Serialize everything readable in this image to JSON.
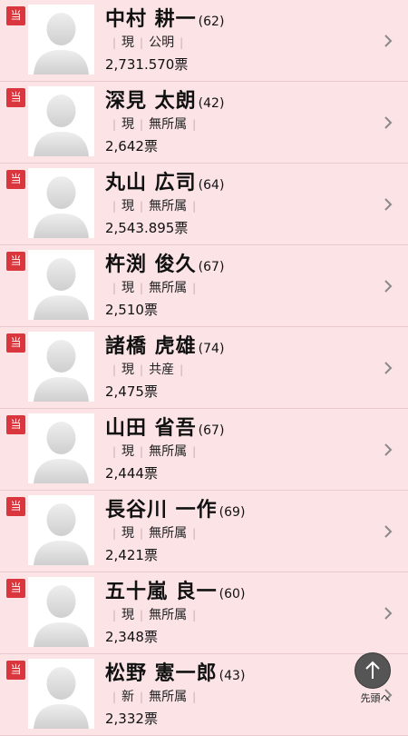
{
  "candidates": [
    {
      "badge": "当",
      "name": "中村 耕一",
      "age": "(62)",
      "status": "現",
      "party": "公明",
      "votes": "2,731.570票"
    },
    {
      "badge": "当",
      "name": "深見 太朗",
      "age": "(42)",
      "status": "現",
      "party": "無所属",
      "votes": "2,642票"
    },
    {
      "badge": "当",
      "name": "丸山 広司",
      "age": "(64)",
      "status": "現",
      "party": "無所属",
      "votes": "2,543.895票"
    },
    {
      "badge": "当",
      "name": "杵渕 俊久",
      "age": "(67)",
      "status": "現",
      "party": "無所属",
      "votes": "2,510票"
    },
    {
      "badge": "当",
      "name": "諸橋 虎雄",
      "age": "(74)",
      "status": "現",
      "party": "共産",
      "votes": "2,475票"
    },
    {
      "badge": "当",
      "name": "山田 省吾",
      "age": "(67)",
      "status": "現",
      "party": "無所属",
      "votes": "2,444票"
    },
    {
      "badge": "当",
      "name": "長谷川 一作",
      "age": "(69)",
      "status": "現",
      "party": "無所属",
      "votes": "2,421票"
    },
    {
      "badge": "当",
      "name": "五十嵐 良一",
      "age": "(60)",
      "status": "現",
      "party": "無所属",
      "votes": "2,348票"
    },
    {
      "badge": "当",
      "name": "松野 憲一郎",
      "age": "(43)",
      "status": "新",
      "party": "無所属",
      "votes": "2,332票"
    }
  ],
  "scroll_top": {
    "label": "先頭へ",
    "icon": "arrow-up-icon"
  }
}
